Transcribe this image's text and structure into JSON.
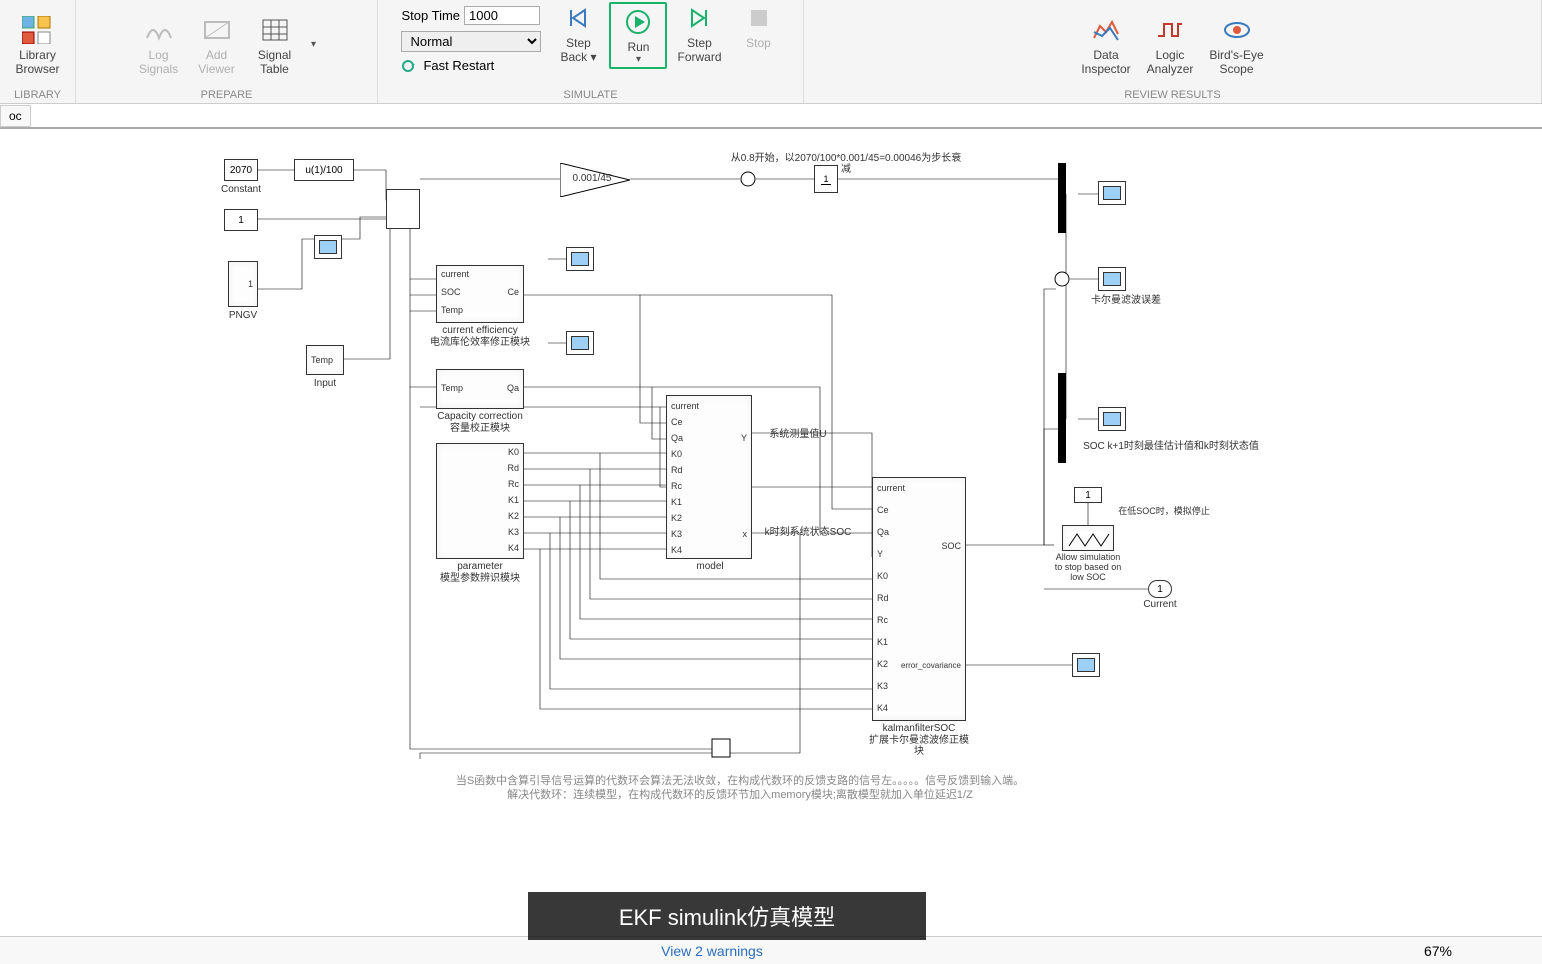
{
  "ribbon": {
    "library": {
      "label1": "Library",
      "label2": "Browser",
      "group": "LIBRARY"
    },
    "prepare": {
      "logsignals1": "Log",
      "logsignals2": "Signals",
      "addviewer1": "Add",
      "addviewer2": "Viewer",
      "signaltable1": "Signal",
      "signaltable2": "Table",
      "group": "PREPARE"
    },
    "simulate": {
      "stoptime_label": "Stop Time",
      "stoptime_value": "1000",
      "mode": "Normal",
      "fastrestart": "Fast Restart",
      "stepback1": "Step",
      "stepback2": "Back",
      "run": "Run",
      "stepfwd1": "Step",
      "stepfwd2": "Forward",
      "stop": "Stop",
      "group": "SIMULATE"
    },
    "review": {
      "di1": "Data",
      "di2": "Inspector",
      "la1": "Logic",
      "la2": "Analyzer",
      "be1": "Bird's-Eye",
      "be2": "Scope",
      "group": "REVIEW RESULTS"
    }
  },
  "subbar": {
    "tab": "oc"
  },
  "blocks": {
    "constant": {
      "value": "2070",
      "label": "Constant"
    },
    "gain1": "u(1)/100",
    "gain2": "0.001/45",
    "integrator": "1\ns",
    "constOne": "1",
    "pngv": "PNGV",
    "pngv_in": "1",
    "temp": "Temp",
    "temp_lbl": "Input",
    "ce": {
      "title": "current efficiency",
      "sub": "电流库伦效率修正模块",
      "p1": "current",
      "p2": "SOC",
      "p3": "Temp",
      "out": "Ce"
    },
    "cap": {
      "title": "Capacity correction",
      "sub": "容量校正模块",
      "p1": "Temp",
      "out": "Qa"
    },
    "param": {
      "title": "parameter",
      "sub": "模型参数辨识模块",
      "o1": "K0",
      "o2": "Rd",
      "o3": "Rc",
      "o4": "K1",
      "o5": "K2",
      "o6": "K3",
      "o7": "K4"
    },
    "model": {
      "title": "model",
      "i1": "current",
      "i2": "Ce",
      "i3": "Qa",
      "i4": "K0",
      "i5": "Rd",
      "i6": "Rc",
      "i7": "K1",
      "i8": "K2",
      "i9": "K3",
      "i10": "K4",
      "o1": "Y",
      "o2": "x",
      "lab1": "系统测量值U",
      "lab2": "k时刻系统状态SOC"
    },
    "kalman": {
      "title": "kalmanfilterSOC",
      "sub": "扩展卡尔曼滤波修正模块",
      "i1": "current",
      "i2": "Ce",
      "i3": "Qa",
      "i4": "Y",
      "i5": "K0",
      "i6": "Rd",
      "i7": "Rc",
      "i8": "K1",
      "i9": "K2",
      "i10": "K3",
      "i11": "K4",
      "o1": "SOC",
      "o2": "error_covariance"
    },
    "stopblk": {
      "l1": "Allow simulation",
      "l2": "to stop based on",
      "l3": "low SOC",
      "const": "1",
      "note": "在低SOC时，模拟停止"
    },
    "currentOut": {
      "val": "1",
      "lbl": "Current"
    },
    "note_top": "从0.8开始，以2070/100*0.001/45=0.00046为步长衰减",
    "note_kalman": "卡尔曼滤波误差",
    "note_soc": "SOC k+1时刻最佳估计值和k时刻状态值"
  },
  "footer": {
    "line1": "当S函数中含算引导信号运算的代数环会算法无法收敛，在构成代数环的反馈支路的信号左。。。。。信号反馈到输入端。",
    "line2": "解决代数环：连续模型，在构成代数环的反馈环节加入memory模块;离散模型就加入单位延迟1/Z"
  },
  "status": {
    "warnings": "View 2 warnings",
    "zoom": "67%"
  },
  "caption": "EKF simulink仿真模型"
}
